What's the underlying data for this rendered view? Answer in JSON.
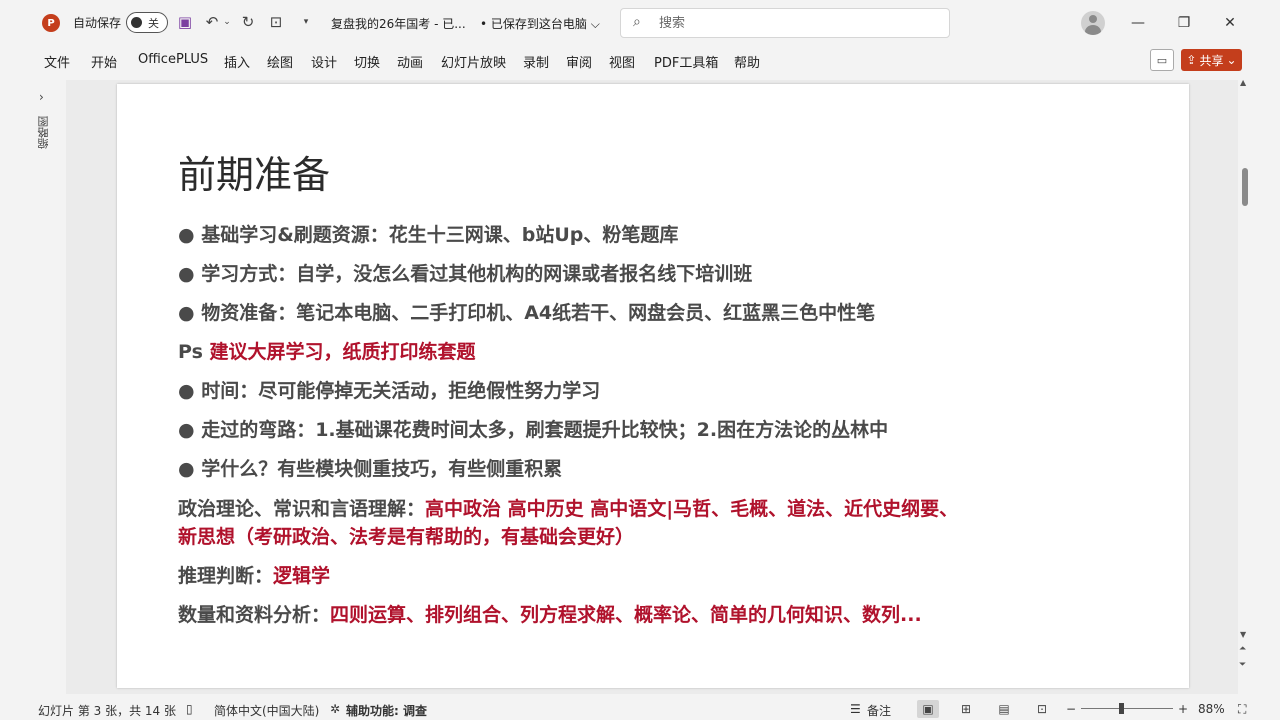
{
  "titlebar": {
    "autosave_label": "自动保存",
    "autosave_state": "关",
    "doc_title": "复盘我的26年国考 - 已...",
    "doc_status": "• 已保存到这台电脑 ⌵",
    "search_placeholder": "搜索"
  },
  "ribbon": {
    "tabs": [
      "文件",
      "开始",
      "OfficePLUS",
      "插入",
      "绘图",
      "设计",
      "切换",
      "动画",
      "幻灯片放映",
      "录制",
      "审阅",
      "视图",
      "PDF工具箱",
      "帮助"
    ],
    "share_label": "共享"
  },
  "thumbs_pane": {
    "label": "缩略图"
  },
  "slide": {
    "title": "前期准备",
    "lines": {
      "l1": "● 基础学习&刷题资源：花生十三网课、b站Up、粉笔题库",
      "l2": "● 学习方式：自学，没怎么看过其他机构的网课或者报名线下培训班",
      "l3": "● 物资准备：笔记本电脑、二手打印机、A4纸若干、网盘会员、红蓝黑三色中性笔",
      "l4_a": "Ps ",
      "l4_b": "建议大屏学习，纸质打印练套题",
      "l5": "● 时间：尽可能停掉无关活动，拒绝假性努力学习",
      "l6": "● 走过的弯路：1.基础课花费时间太多，刷套题提升比较快；2.困在方法论的丛林中",
      "l7": "● 学什么？有些模块侧重技巧，有些侧重积累",
      "l8_a": "政治理论、常识和言语理解：",
      "l8_b": "高中政治 高中历史 高中语文|马哲、毛概、道法、近代史纲要、",
      "l9": "新思想（考研政治、法考是有帮助的，有基础会更好）",
      "l10_a": "推理判断：",
      "l10_b": "逻辑学",
      "l11_a": "数量和资料分析：",
      "l11_b": "四则运算、排列组合、列方程求解、概率论、简单的几何知识、数列..."
    }
  },
  "statusbar": {
    "slide_info": "幻灯片 第 3 张，共 14 张",
    "language": "简体中文(中国大陆)",
    "accessibility": "辅助功能: 调查",
    "notes": "备注",
    "zoom": "88%"
  },
  "colors": {
    "accent_red": "#b0122c",
    "brand": "#c43e1c"
  }
}
